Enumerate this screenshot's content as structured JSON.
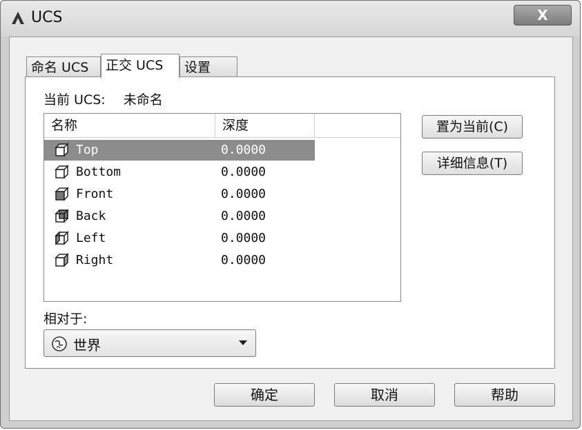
{
  "window": {
    "title": "UCS",
    "close_label": "X"
  },
  "tabs": [
    {
      "label": "命名 UCS"
    },
    {
      "label": "正交 UCS"
    },
    {
      "label": "设置"
    }
  ],
  "panel": {
    "current_label": "当前 UCS:",
    "current_value": "未命名",
    "columns": [
      "名称",
      "深度"
    ],
    "rows": [
      {
        "name": "Top",
        "depth": "0.0000",
        "icon": "cube-top-icon"
      },
      {
        "name": "Bottom",
        "depth": "0.0000",
        "icon": "cube-bottom-icon"
      },
      {
        "name": "Front",
        "depth": "0.0000",
        "icon": "cube-front-icon"
      },
      {
        "name": "Back",
        "depth": "0.0000",
        "icon": "cube-back-icon"
      },
      {
        "name": "Left",
        "depth": "0.0000",
        "icon": "cube-left-icon"
      },
      {
        "name": "Right",
        "depth": "0.0000",
        "icon": "cube-right-icon"
      }
    ],
    "selected_row": "Top",
    "set_current_button": "置为当前(C)",
    "details_button": "详细信息(T)",
    "relative_label": "相对于:",
    "relative_value": "世界"
  },
  "footer": {
    "ok": "确定",
    "cancel": "取消",
    "help": "帮助"
  }
}
